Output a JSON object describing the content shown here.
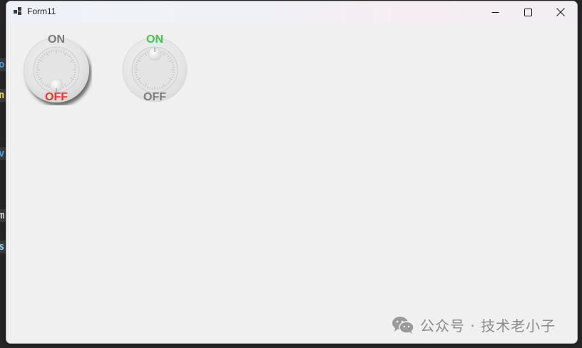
{
  "window": {
    "title": "Form11",
    "minimize_icon": "minimize-icon",
    "maximize_icon": "maximize-icon",
    "close_icon": "close-icon"
  },
  "background_fragments": [
    "o",
    "n",
    "v",
    "m",
    "s"
  ],
  "knobs": [
    {
      "name": "knob-switch-1",
      "on_label": "ON",
      "off_label": "OFF",
      "state": "OFF",
      "on_color": "#7a7a7a",
      "off_color": "#ff2a2a"
    },
    {
      "name": "knob-switch-2",
      "on_label": "ON",
      "off_label": "OFF",
      "state": "ON",
      "on_color": "#3cc94f",
      "off_color": "#7a7a7a"
    }
  ],
  "watermark": {
    "text": "公众号 · 技术老小子",
    "icon": "wechat-icon"
  },
  "colors": {
    "form_background": "#f0f0f0",
    "on_active": "#3cc94f",
    "off_active": "#ff2a2a",
    "inactive_label": "#7a7a7a"
  }
}
